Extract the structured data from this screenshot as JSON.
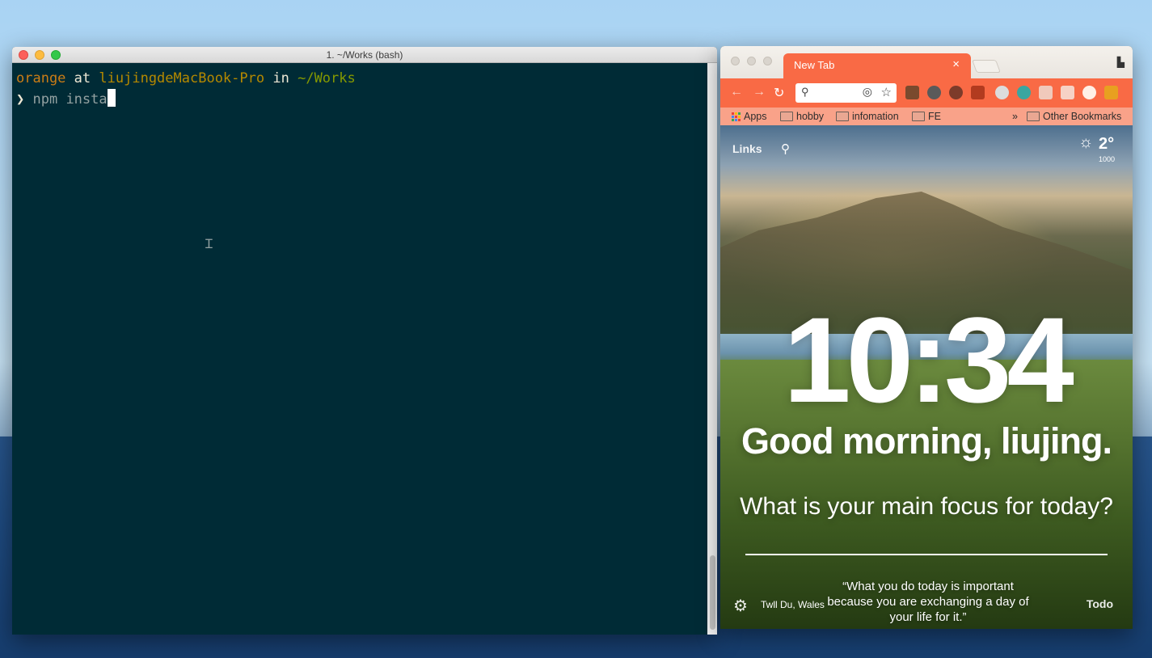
{
  "terminal": {
    "title": "1. ~/Works (bash)",
    "prompt_line": {
      "user": "orange",
      "at": "at",
      "host": "liujingdeMacBook-Pro",
      "in": "in",
      "path": "~/Works"
    },
    "prompt_symbol": "❯",
    "command": "npm insta"
  },
  "browser": {
    "tab_title": "New Tab",
    "tab_close": "×",
    "bookmarks": {
      "apps": "Apps",
      "items": [
        "hobby",
        "infomation",
        "FE"
      ],
      "overflow": "»",
      "other": "Other Bookmarks"
    },
    "content": {
      "links": "Links",
      "temperature": "2°",
      "weather_sub": "1000",
      "clock": "10:34",
      "greeting": "Good morning, liujing.",
      "focus_question": "What is your main focus for today?",
      "location": "Twll Du, Wales",
      "quote": "“What you do today is important because you are exchanging a day of your life for it.”",
      "todo": "Todo"
    }
  },
  "colors": {
    "terminal_bg": "#002b36",
    "tab_accent": "#f96a45",
    "bookmark_bar": "#f9a289"
  },
  "icons": {
    "close": "close-icon",
    "minimize": "minimize-icon",
    "zoom": "zoom-icon",
    "search": "search-icon",
    "star": "star-icon",
    "gear": "gear-icon",
    "weather": "sun-icon",
    "folder": "folder-icon"
  }
}
